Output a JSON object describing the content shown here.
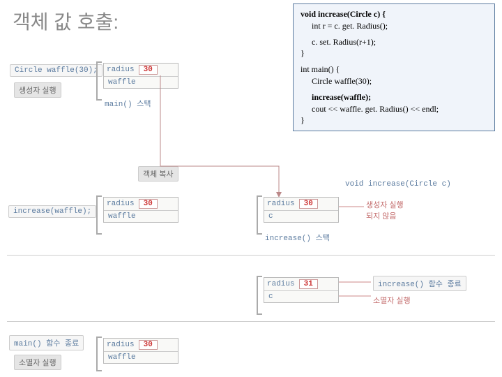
{
  "title": "객체 값 호출:",
  "code": {
    "line1": "void increase(Circle c) {",
    "line2": "int r = c. get. Radius();",
    "line3": "c. set. Radius(r+1);",
    "line4": "}",
    "line5": "int main() {",
    "line6": "Circle waffle(30);",
    "line7": "increase(waffle);",
    "line8": "cout << waffle. get. Radius() << endl;",
    "line9": "}"
  },
  "anno": {
    "circle_decl": "Circle waffle(30);",
    "ctor_exec": "생성자 실행",
    "main_stack": "main() 스택",
    "objcopy": "객체 복사",
    "increase_call": "increase(waffle);",
    "void_increase": "void increase(Circle c)",
    "noctor": "생성자 실행\n되지 않음",
    "inc_stack": "increase() 스택",
    "inc_end": "increase() 함수 종료",
    "dtor_exec": "소멸자 실행",
    "main_end": "main() 함수 종료"
  },
  "frames": {
    "waffle": {
      "member": "radius",
      "val30": "30",
      "name": "waffle"
    },
    "c": {
      "member": "radius",
      "val30": "30",
      "val31": "31",
      "name": "c"
    }
  }
}
